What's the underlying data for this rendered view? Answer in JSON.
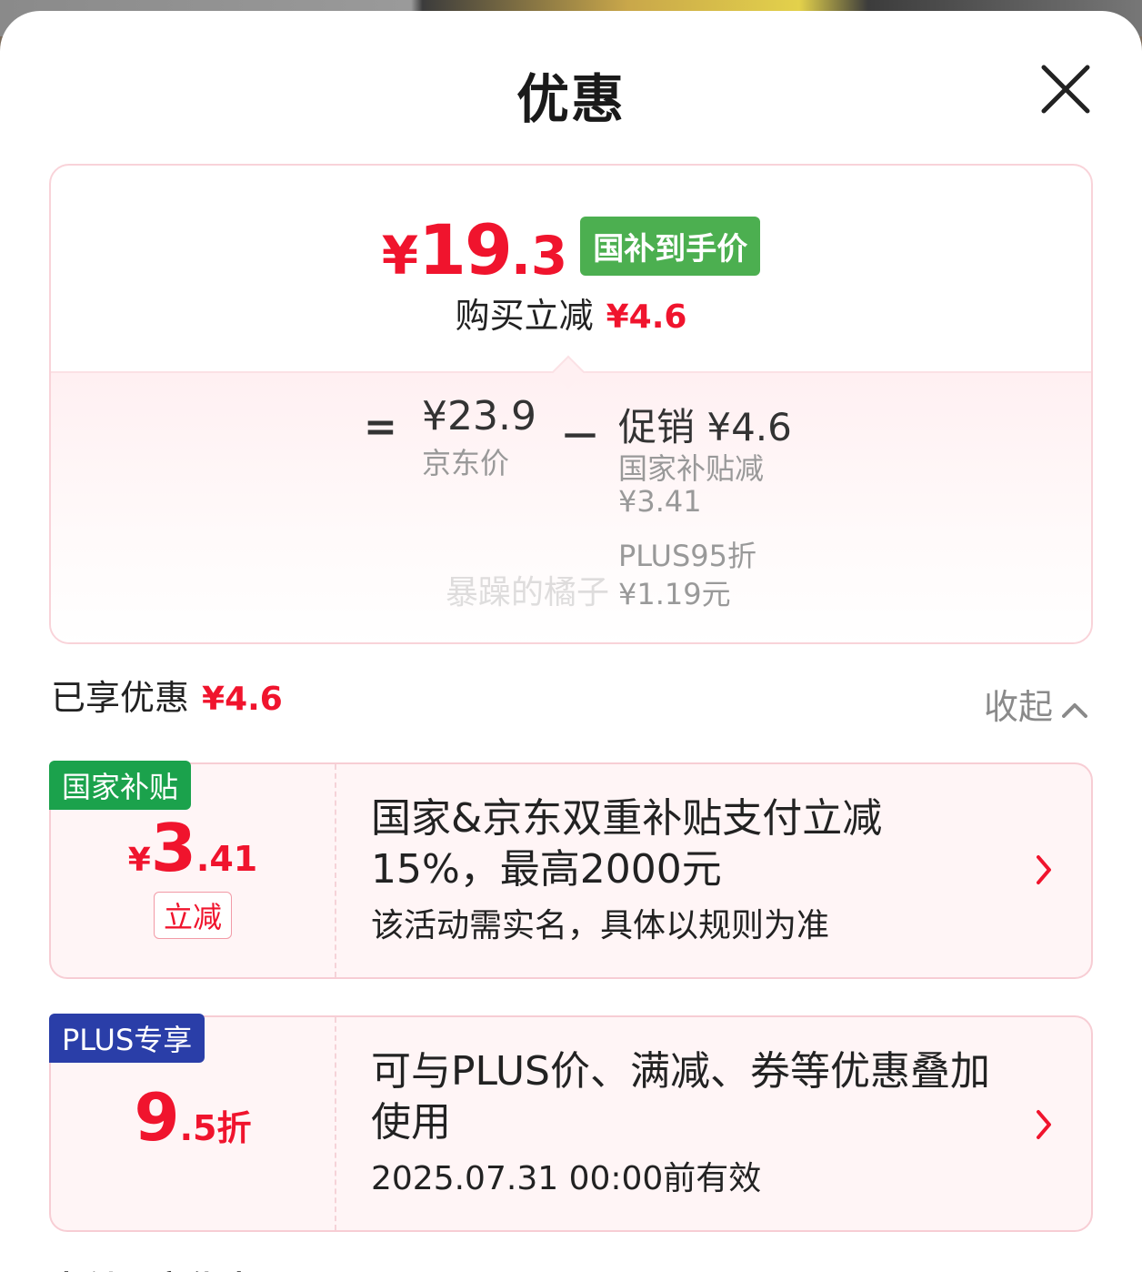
{
  "sheet": {
    "title": "优惠"
  },
  "summary": {
    "price_yen": "¥",
    "price_int": "19",
    "price_dec": ".3",
    "price_badge": "国补到手价",
    "instant_label": "购买立减",
    "instant_amount": "¥4.6",
    "equals": "=",
    "jd_price": "¥23.9",
    "jd_label": "京东价",
    "minus": "－",
    "promo_title": "促销 ¥4.6",
    "promo_lines": [
      "国家补贴减",
      "¥3.41",
      "PLUS95折",
      "¥1.19元"
    ],
    "watermark": "暴躁的橘子"
  },
  "enjoyed": {
    "label": "已享优惠",
    "amount": "¥4.6",
    "collapse_label": "收起"
  },
  "cards": [
    {
      "tag": "国家补贴",
      "amount_yen": "¥",
      "amount_big": "3",
      "amount_small": ".41",
      "pill": "立减",
      "title": "国家&京东双重补贴支付立减15%，最高2000元",
      "subtitle": "该活动需实名，具体以规则为准"
    },
    {
      "tag": "PLUS专享",
      "amount_big": "9",
      "amount_small": ".5折",
      "title": "可与PLUS价、满减、券等优惠叠加使用",
      "subtitle": "2025.07.31 00:00前有效"
    }
  ],
  "bottom_section_title": "支付再享优惠",
  "colors": {
    "accent_red": "#f0142d",
    "badge_green": "#4caf50",
    "tag_green": "#1ba24c",
    "tag_blue": "#2a3ea8"
  },
  "icons": {
    "close": "close-icon",
    "collapse": "chevron-up-icon",
    "card_arrow": "chevron-right-icon"
  }
}
